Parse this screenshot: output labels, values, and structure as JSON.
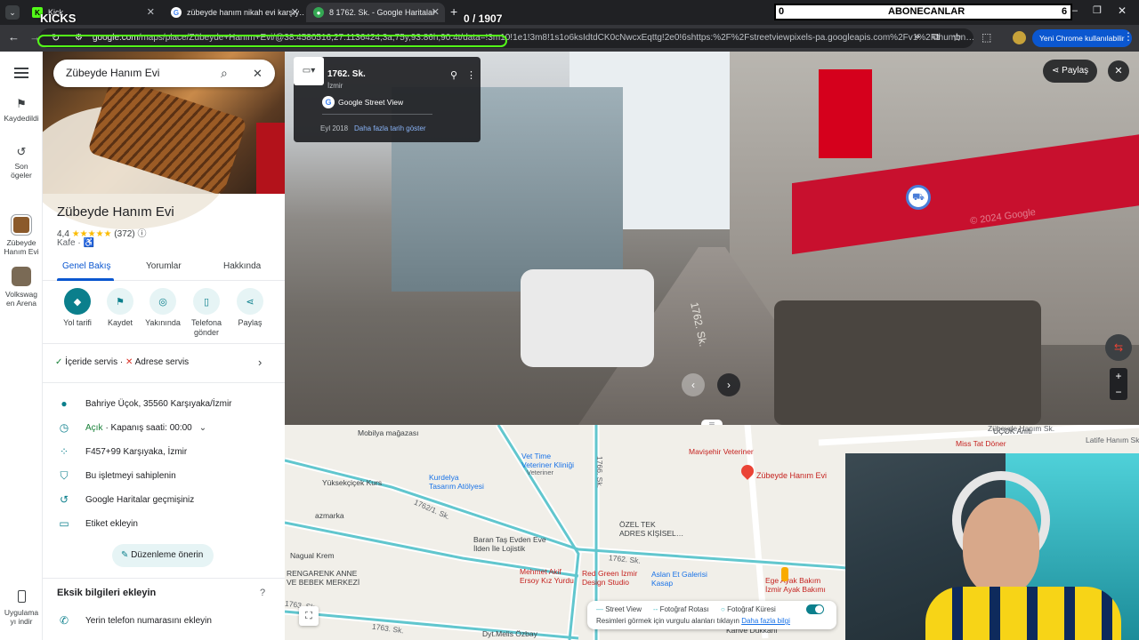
{
  "browser": {
    "tabs": [
      {
        "label": "Kick",
        "active": false
      },
      {
        "label": "zübeyde hanım nikah evi karşıy…",
        "active": false
      },
      {
        "label": "8 1762. Sk. - Google Haritalar",
        "active": true
      }
    ],
    "url_prefix": "google.com",
    "url_rest": "/maps/place/Zübeyde+Hanım+Evi/@38.4580516,27.1136424,3a,75y,93.86h,90.4t/data=!3m10!1e1!3m8!1s1o6ksIdtdCK0cNwcxEqttg!2e0!6shttps:%2F%2Fstreetviewpixels-pa.googleapis.com%2Fv1%2Fthumbn…",
    "chrome_badge": "Yeni Chrome kullanılabilir"
  },
  "stream_overlay": {
    "brand": "KICKS",
    "counter": "0 / 1907",
    "subs_left": "0",
    "subs_label": "ABONECANLAR",
    "subs_right": "6"
  },
  "rail": {
    "saved": "Kaydedildi",
    "recent": "Son\nögeler",
    "place1": "Zübeyde\nHanım Evi",
    "place2": "Volkswag\nen Arena",
    "get_app": "Uygulama\nyı indir"
  },
  "panel": {
    "search_value": "Zübeyde Hanım Evi",
    "title": "Zübeyde Hanım Evi",
    "rating": "4,4",
    "stars": "★★★★★",
    "reviews": "(372)",
    "category": "Kafe ·",
    "tabs": [
      "Genel Bakış",
      "Yorumlar",
      "Hakkında"
    ],
    "actions": [
      {
        "label": "Yol tarifi",
        "icon": "directions-icon"
      },
      {
        "label": "Kaydet",
        "icon": "bookmark-icon"
      },
      {
        "label": "Yakınında",
        "icon": "nearby-icon"
      },
      {
        "label": "Telefona\ngönder",
        "icon": "phone-send-icon"
      },
      {
        "label": "Paylaş",
        "icon": "share-icon"
      }
    ],
    "service_in": "İçeride servis ·",
    "service_out": "Adrese servis",
    "address": "Bahriye Üçok, 35560 Karşıyaka/İzmir",
    "open": "Açık",
    "hours": "· Kapanış saati: 00:00",
    "plus_code": "F457+99 Karşıyaka, İzmir",
    "claim": "Bu işletmeyi sahiplenin",
    "history": "Google Haritalar geçmişiniz",
    "label": "Etiket ekleyin",
    "suggest_edit": "Düzenleme önerin",
    "missing_title": "Eksik bilgileri ekleyin",
    "add_phone": "Yerin telefon numarasını ekleyin"
  },
  "streetview": {
    "street": "1762. Sk.",
    "city": "İzmir",
    "source": "Google Street View",
    "date": "Eyl 2018",
    "more_dates": "Daha fazla tarih göster",
    "share": "Paylaş",
    "watermark": "© 2024 Google",
    "painted": "1762. Sk."
  },
  "map": {
    "labels": [
      {
        "text": "Mobilya mağazası",
        "cls": "",
        "name": "map-label-mobilya"
      },
      {
        "text": "Vet Time\nVeteriner Kliniği",
        "cls": "mtext-teal",
        "name": "map-label-vettime"
      },
      {
        "text": "Veteriner",
        "cls": "",
        "name": "map-label-veteriner"
      },
      {
        "text": "Mavişehir Veteriner",
        "cls": "mtext-red",
        "name": "map-label-mavisehir"
      },
      {
        "text": "Zübeyde Hanım Evi",
        "cls": "mtext-red",
        "name": "map-label-zubeyde"
      },
      {
        "text": "Yüksekçiçek Kurs",
        "cls": "",
        "name": "map-label-yuksekcicek"
      },
      {
        "text": "Kurdelya\nTasarım Atölyesi",
        "cls": "mtext-teal",
        "name": "map-label-kurdelya"
      },
      {
        "text": "azmarka",
        "cls": "",
        "name": "map-label-azmarka"
      },
      {
        "text": "Nagual Krem",
        "cls": "",
        "name": "map-label-nagual"
      },
      {
        "text": "Baran Taş Evden Eve\nİlden İle Lojistik",
        "cls": "",
        "name": "map-label-baran"
      },
      {
        "text": "ÖZEL TEK\nADRES KİŞİSEL…",
        "cls": "",
        "name": "map-label-ozeltek"
      },
      {
        "text": "Mehmet Akif\nErsoy Kız Yurdu",
        "cls": "mtext-red",
        "name": "map-label-mehmetakif"
      },
      {
        "text": "Red Green İzmir\nDesign Studio",
        "cls": "mtext-red",
        "name": "map-label-redgreen"
      },
      {
        "text": "Aslan Et Galerisi\nKasap",
        "cls": "mtext-teal",
        "name": "map-label-aslan"
      },
      {
        "text": "Ege Ayak Bakım\nİzmir Ayak Bakımı",
        "cls": "mtext-red",
        "name": "map-label-ege"
      },
      {
        "text": "RENGARENK ANNE\nVE BEBEK MERKEZİ",
        "cls": "",
        "name": "map-label-rengarenk"
      },
      {
        "text": "Dyt.Melis Özbay",
        "cls": "",
        "name": "map-label-melis"
      },
      {
        "text": "Kahve Dükkanı",
        "cls": "",
        "name": "map-label-kahve"
      },
      {
        "text": "Miss Tat Döner",
        "cls": "mtext-red",
        "name": "map-label-misstat"
      },
      {
        "text": "UÇOK Anıtı",
        "cls": "",
        "name": "map-label-ucok"
      }
    ],
    "streets": [
      "1766. Sk.",
      "1762/1. Sk.",
      "1762. Sk.",
      "1763. Sk.",
      "Zübeyde Hanım Sk.",
      "Latife Hanım Sk.",
      "1763. Sk."
    ],
    "legend": {
      "sv": "Street View",
      "route": "Fotoğraf Rotası",
      "sphere": "Fotoğraf Küresi",
      "hint": "Resimleri görmek için vurgulu alanları tıklayın",
      "more": "Daha fazla bilgi"
    }
  }
}
